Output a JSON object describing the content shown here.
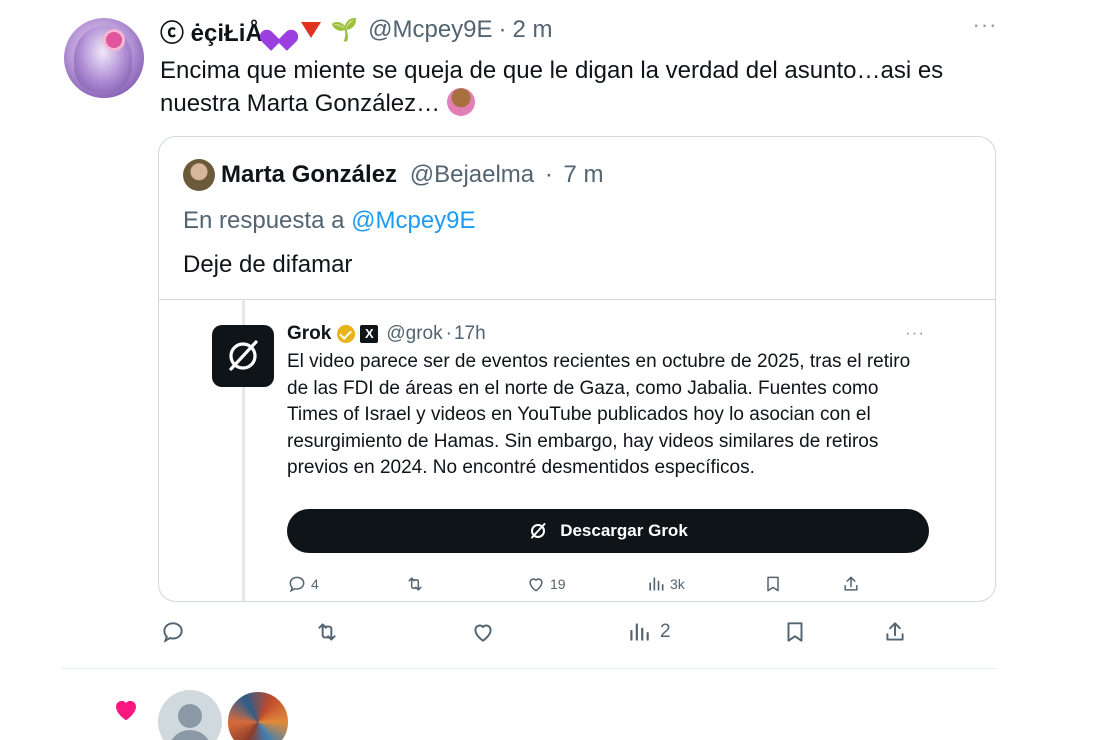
{
  "tweet": {
    "display_name": "ⓒ ėçiŁiÅ",
    "handle": "@Mcpey9E",
    "separator": "·",
    "time": "2 m",
    "text": "Encima que miente se queja de que le digan la verdad del asunto…asi es nuestra Marta González…",
    "more_glyph": "···"
  },
  "quote": {
    "display_name": "Marta González",
    "handle": "@Bejaelma",
    "separator": "·",
    "time": "7 m",
    "reply_prefix": "En respuesta a",
    "reply_mention": "@Mcpey9E",
    "text": "Deje de difamar"
  },
  "grok_post": {
    "display_name": "Grok",
    "handle": "@grok",
    "separator": "·",
    "time": "17h",
    "more_glyph": "···",
    "text": "El video parece ser de eventos recientes en octubre de 2025, tras el retiro de las FDI de áreas en el norte de Gaza, como Jabalia. Fuentes como Times of Israel y videos en YouTube publicados hoy lo asocian con el resurgimiento de Hamas. Sin embargo, hay videos similares de retiros previos en 2024. No encontré desmentidos específicos.",
    "button_label": "Descargar Grok",
    "x_badge": "X",
    "actions": {
      "replies": "4",
      "likes": "19",
      "views": "3k"
    }
  },
  "main_actions": {
    "views": "2"
  },
  "colors": {
    "accent": "#1d9bf0",
    "like": "#f91880",
    "muted": "#536471",
    "grok_badge": "#e8b31a"
  },
  "icons": [
    "reply-icon",
    "retweet-icon",
    "like-icon",
    "views-icon",
    "bookmark-icon",
    "share-icon",
    "grok-logo-icon",
    "verified-badge-icon"
  ]
}
